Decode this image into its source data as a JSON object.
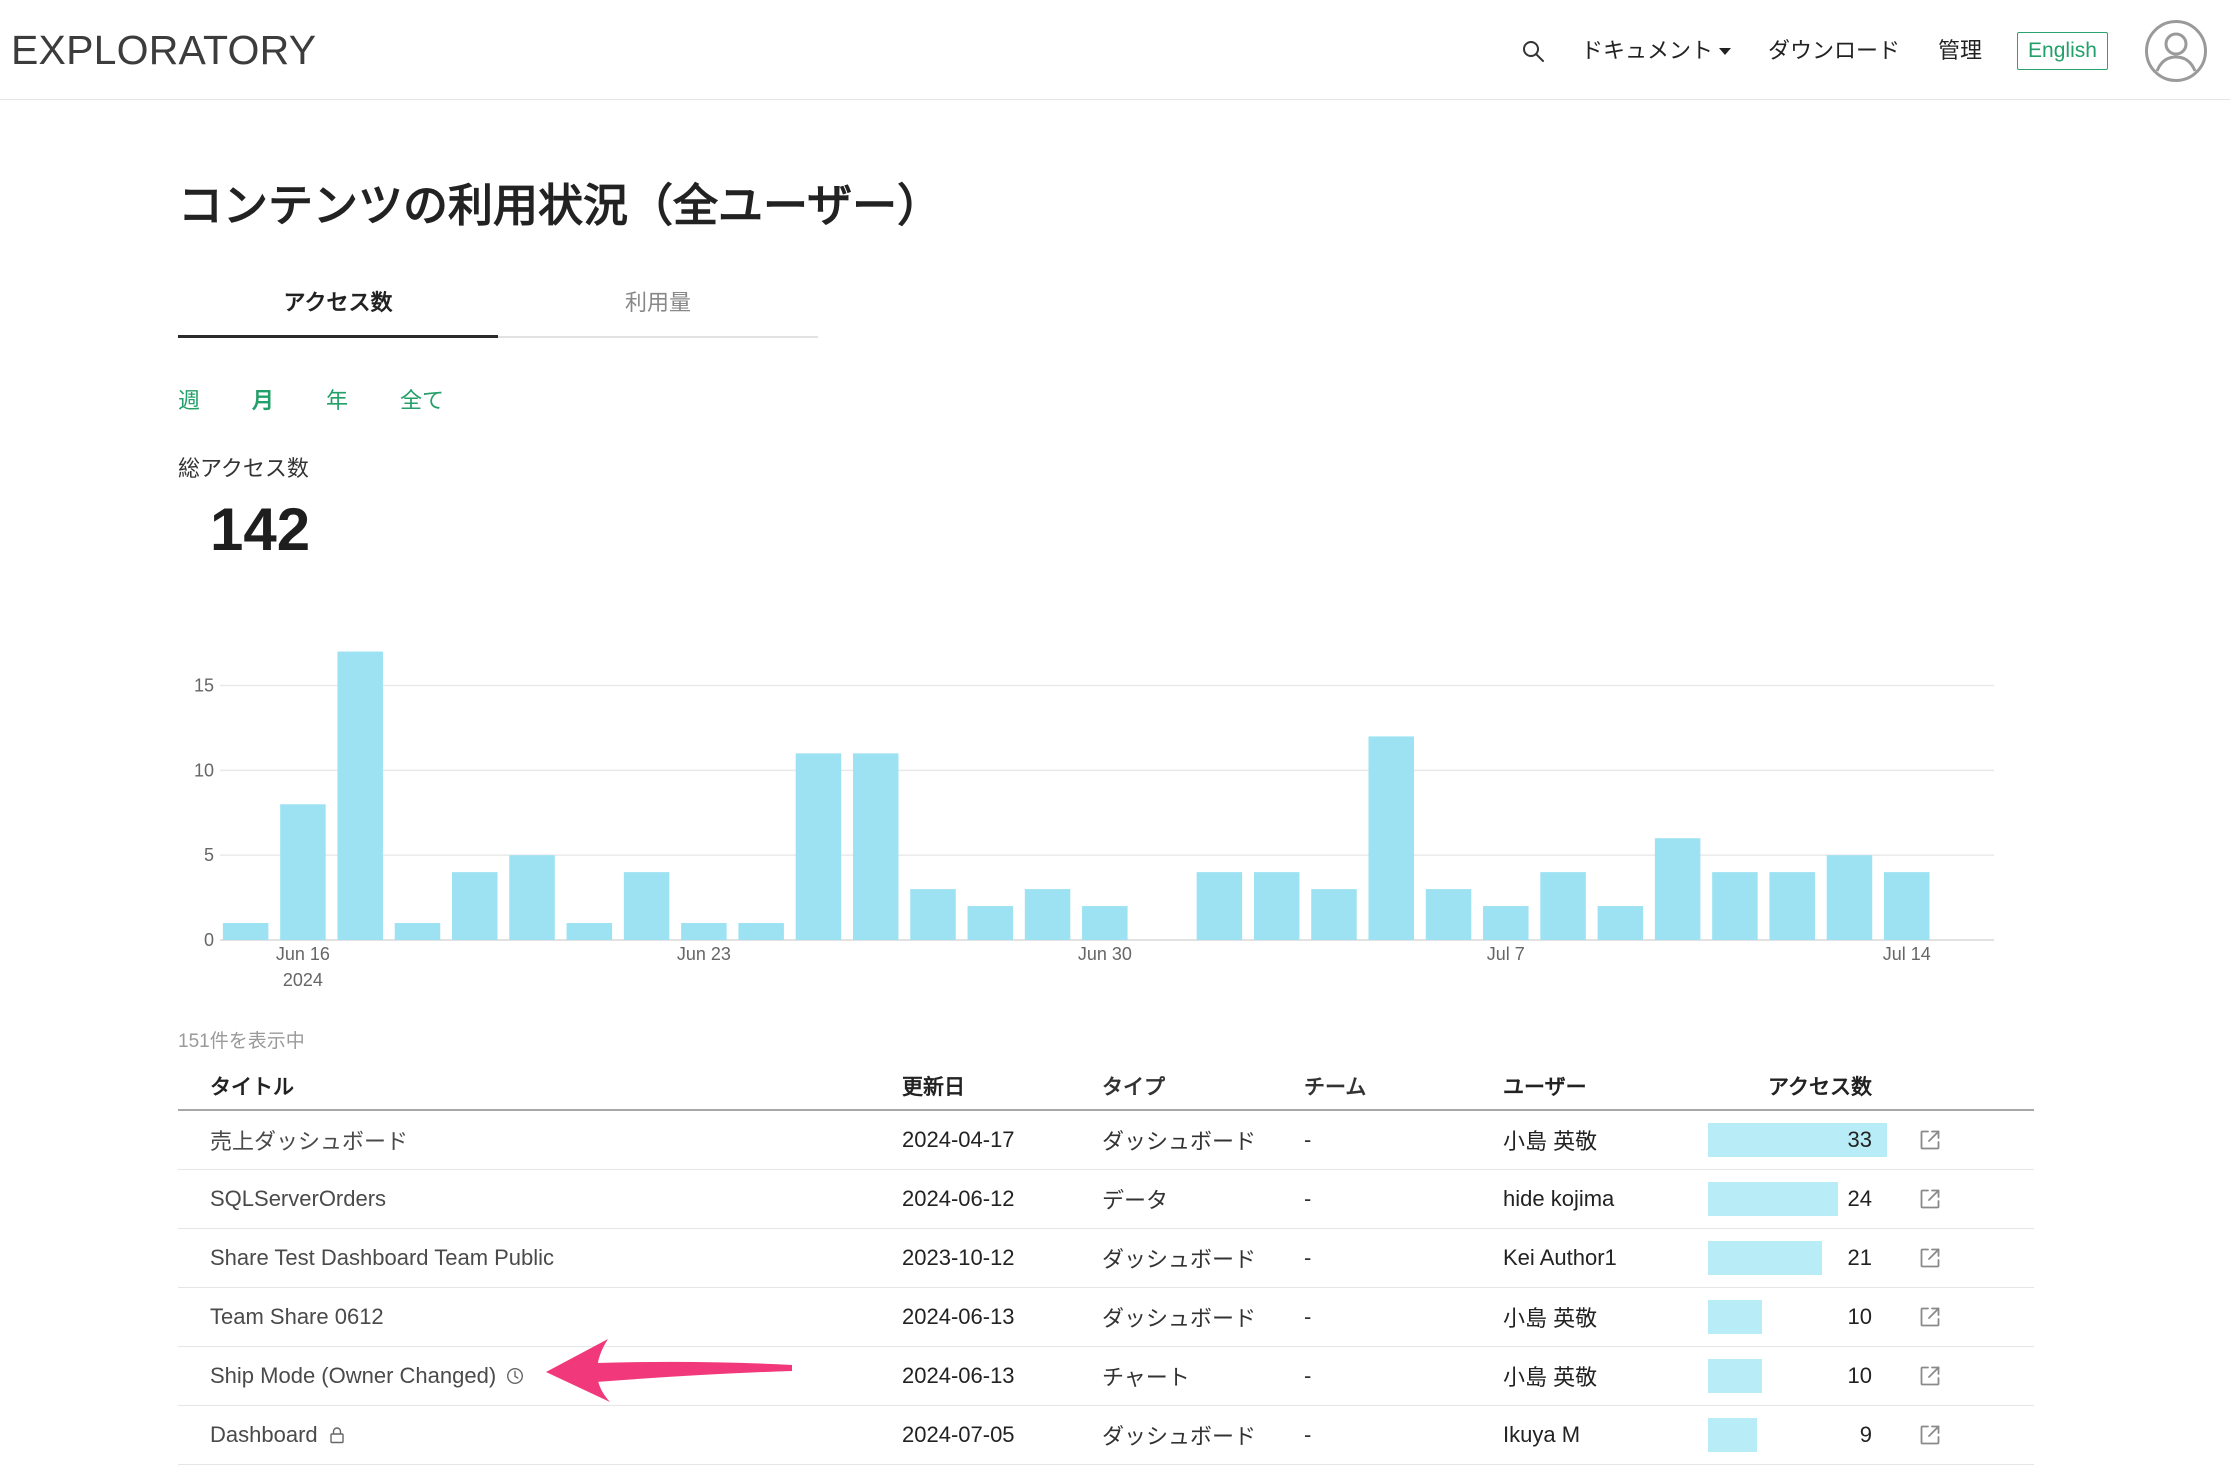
{
  "header": {
    "logo": "EXPLORATORY",
    "search_icon": "search-icon",
    "nav": {
      "documents": "ドキュメント",
      "documents_caret_icon": "caret-down-icon",
      "download": "ダウンロード",
      "admin": "管理",
      "language_button": "English"
    },
    "avatar_icon": "user-avatar-icon"
  },
  "page": {
    "title": "コンテンツの利用状況（全ユーザー）",
    "tabs": [
      {
        "label": "アクセス数",
        "active": true
      },
      {
        "label": "利用量",
        "active": false
      }
    ],
    "periods": [
      {
        "label": "週",
        "active": false
      },
      {
        "label": "月",
        "active": true
      },
      {
        "label": "年",
        "active": false
      },
      {
        "label": "全て",
        "active": false
      }
    ],
    "total_label": "総アクセス数",
    "total_value": "142"
  },
  "chart_data": {
    "type": "bar",
    "x": [
      "2024-06-15",
      "2024-06-16",
      "2024-06-17",
      "2024-06-18",
      "2024-06-19",
      "2024-06-20",
      "2024-06-21",
      "2024-06-22",
      "2024-06-23",
      "2024-06-24",
      "2024-06-25",
      "2024-06-26",
      "2024-06-27",
      "2024-06-28",
      "2024-06-29",
      "2024-06-30",
      "2024-07-01",
      "2024-07-02",
      "2024-07-03",
      "2024-07-04",
      "2024-07-05",
      "2024-07-06",
      "2024-07-07",
      "2024-07-08",
      "2024-07-09",
      "2024-07-10",
      "2024-07-11",
      "2024-07-12",
      "2024-07-13",
      "2024-07-14"
    ],
    "values": [
      1,
      8,
      17,
      1,
      4,
      5,
      1,
      4,
      1,
      1,
      11,
      11,
      3,
      2,
      3,
      2,
      0,
      4,
      4,
      3,
      12,
      3,
      2,
      4,
      2,
      6,
      4,
      4,
      5,
      4
    ],
    "x_tick_labels": [
      {
        "x": "2024-06-16",
        "label": "Jun 16",
        "sublabel": "2024"
      },
      {
        "x": "2024-06-23",
        "label": "Jun 23"
      },
      {
        "x": "2024-06-30",
        "label": "Jun 30"
      },
      {
        "x": "2024-07-07",
        "label": "Jul 7"
      },
      {
        "x": "2024-07-14",
        "label": "Jul 14"
      }
    ],
    "y_ticks": [
      0,
      5,
      10,
      15
    ],
    "ylim": [
      0,
      17
    ],
    "grid": true,
    "legend": false,
    "bar_color": "#9ce2f2"
  },
  "table": {
    "count_text": "151件を表示中",
    "columns": {
      "title": "タイトル",
      "updated": "更新日",
      "type": "タイプ",
      "team": "チーム",
      "user": "ユーザー",
      "access": "アクセス数"
    },
    "rows": [
      {
        "title": "売上ダッシュボード",
        "updated": "2024-04-17",
        "type": "ダッシュボード",
        "team": "-",
        "user": "小島 英敬",
        "access": 33
      },
      {
        "title": "SQLServerOrders",
        "updated": "2024-06-12",
        "type": "データ",
        "team": "-",
        "user": "hide kojima",
        "access": 24
      },
      {
        "title": "Share Test Dashboard Team Public",
        "updated": "2023-10-12",
        "type": "ダッシュボード",
        "team": "-",
        "user": "Kei Author1",
        "access": 21
      },
      {
        "title": "Team Share 0612",
        "updated": "2024-06-13",
        "type": "ダッシュボード",
        "team": "-",
        "user": "小島 英敬",
        "access": 10
      },
      {
        "title": "Ship Mode (Owner Changed)",
        "title_icon": "clock-icon",
        "updated": "2024-06-13",
        "type": "チャート",
        "team": "-",
        "user": "小島 英敬",
        "access": 10
      },
      {
        "title": "Dashboard",
        "title_icon": "lock-icon",
        "updated": "2024-07-05",
        "type": "ダッシュボード",
        "team": "-",
        "user": "Ikuya M",
        "access": 9
      }
    ],
    "row_link_icon": "external-link-icon"
  },
  "colors": {
    "accent": "#23a06a",
    "chart_bar": "#9ce2f2",
    "access_bar": "#b8ecf7",
    "annotation_arrow": "#f0387a"
  }
}
